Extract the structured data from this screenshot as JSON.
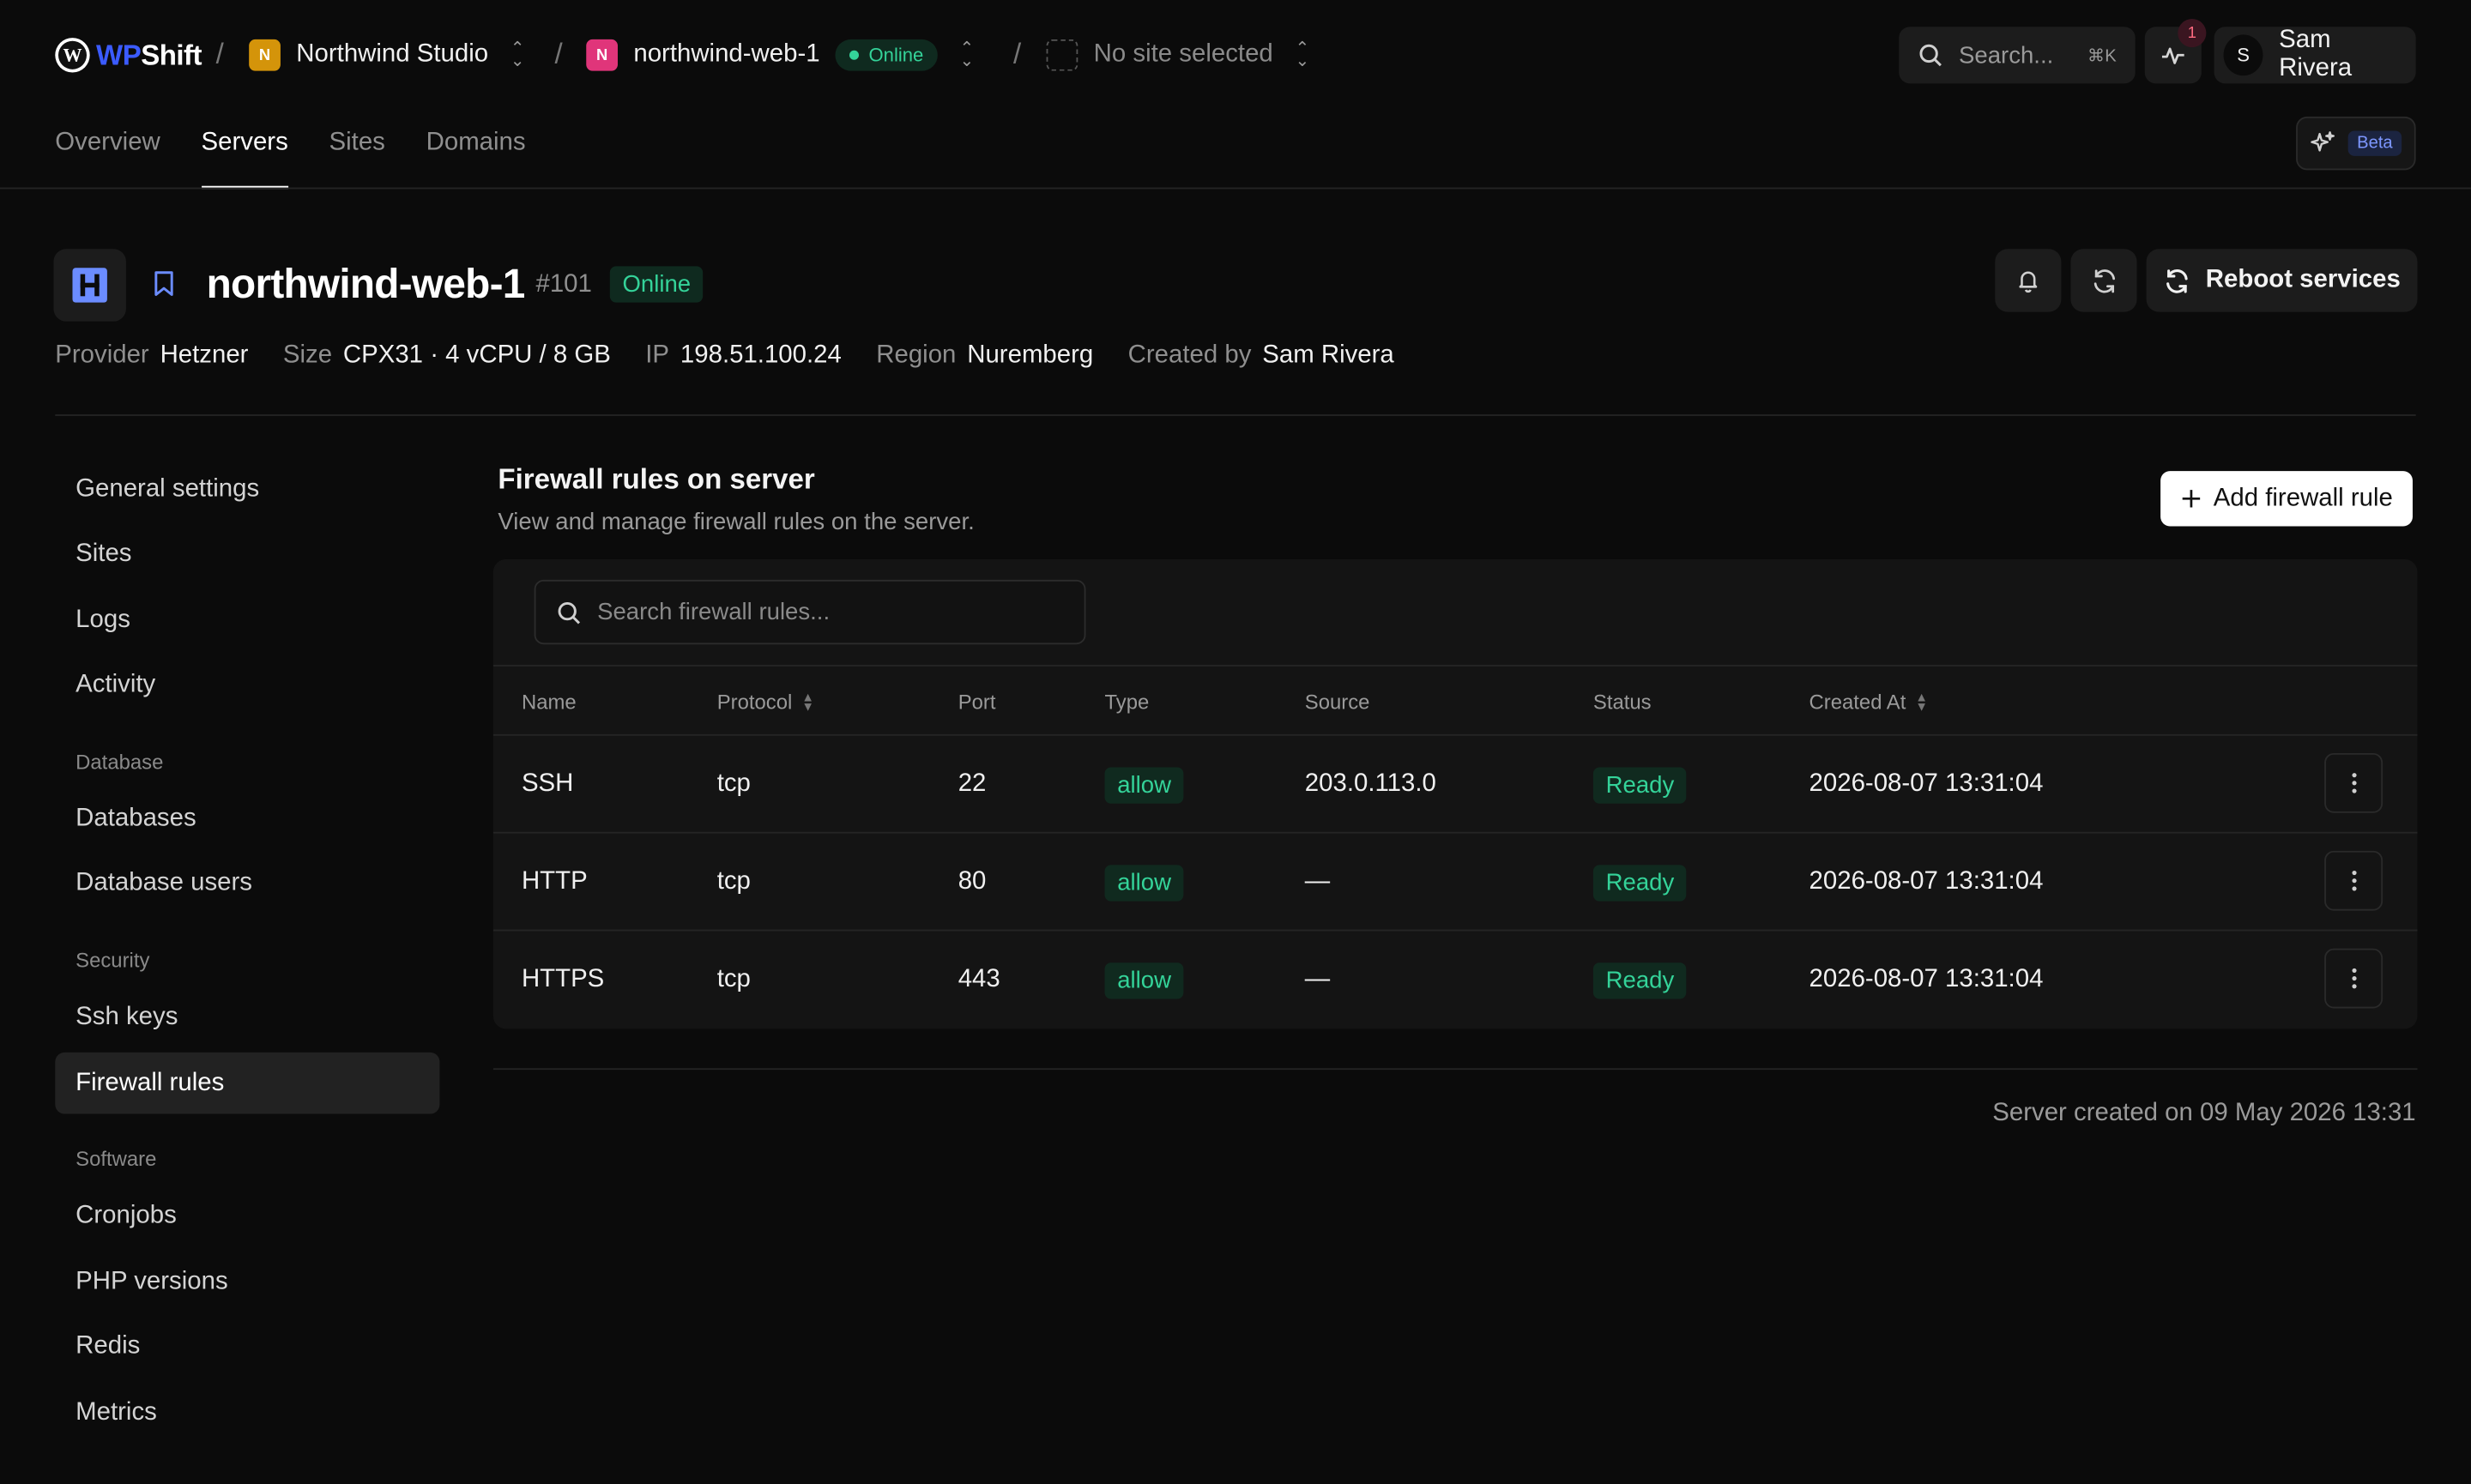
{
  "topbar": {
    "logo_wp": "WP",
    "logo_shift": "Shift",
    "logo_glyph": "W",
    "team": {
      "initial": "N",
      "name": "Northwind Studio",
      "color": "#d4940a"
    },
    "server": {
      "initial": "N",
      "name": "northwind-web-1",
      "status": "Online",
      "color": "#e0357a"
    },
    "site": {
      "name": "No site selected"
    },
    "search_placeholder": "Search...",
    "search_shortcut": "⌘K",
    "activity_count": "1",
    "user": {
      "initial": "S",
      "name": "Sam Rivera"
    },
    "separator": "/"
  },
  "tabs": [
    "Overview",
    "Servers",
    "Sites",
    "Domains"
  ],
  "active_tab": "Servers",
  "beta_label": "Beta",
  "server": {
    "name": "northwind-web-1",
    "id": "#101",
    "status": "Online",
    "reboot_label": "Reboot services",
    "meta": [
      {
        "key": "Provider",
        "value": "Hetzner"
      },
      {
        "key": "Size",
        "value": "CPX31 · 4 vCPU / 8 GB"
      },
      {
        "key": "IP",
        "value": "198.51.100.24"
      },
      {
        "key": "Region",
        "value": "Nuremberg"
      },
      {
        "key": "Created by",
        "value": "Sam Rivera"
      }
    ]
  },
  "sidebar": {
    "items": [
      {
        "label": "General settings"
      },
      {
        "label": "Sites"
      },
      {
        "label": "Logs"
      },
      {
        "label": "Activity"
      },
      {
        "group": "Database"
      },
      {
        "label": "Databases"
      },
      {
        "label": "Database users"
      },
      {
        "group": "Security"
      },
      {
        "label": "Ssh keys"
      },
      {
        "label": "Firewall rules",
        "active": true
      },
      {
        "group": "Software"
      },
      {
        "label": "Cronjobs"
      },
      {
        "label": "PHP versions"
      },
      {
        "label": "Redis"
      },
      {
        "label": "Metrics"
      }
    ]
  },
  "firewall": {
    "title": "Firewall rules on server",
    "subtitle": "View and manage firewall rules on the server.",
    "add_label": "Add firewall rule",
    "search_placeholder": "Search firewall rules...",
    "columns": [
      "Name",
      "Protocol",
      "Port",
      "Type",
      "Source",
      "Status",
      "Created At"
    ],
    "rows": [
      {
        "name": "SSH",
        "protocol": "tcp",
        "port": "22",
        "type": "allow",
        "source": "203.0.113.0",
        "status": "Ready",
        "created": "2026-08-07 13:31:04"
      },
      {
        "name": "HTTP",
        "protocol": "tcp",
        "port": "80",
        "type": "allow",
        "source": "—",
        "status": "Ready",
        "created": "2026-08-07 13:31:04"
      },
      {
        "name": "HTTPS",
        "protocol": "tcp",
        "port": "443",
        "type": "allow",
        "source": "—",
        "status": "Ready",
        "created": "2026-08-07 13:31:04"
      }
    ]
  },
  "footer": "Server created on 09 May 2026 13:31"
}
